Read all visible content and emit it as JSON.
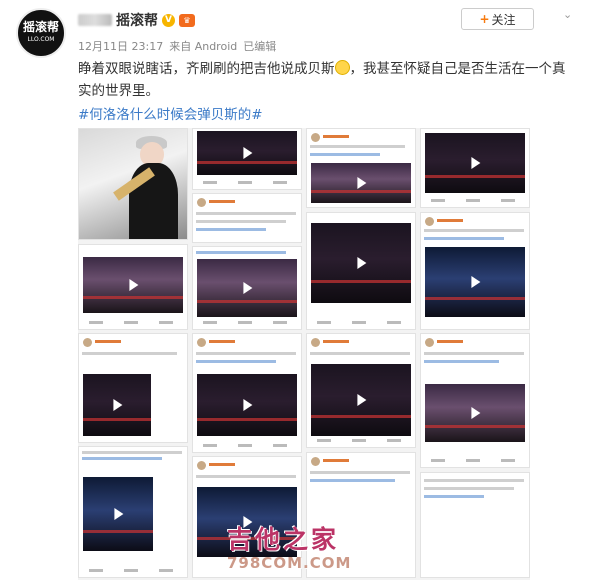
{
  "author": {
    "name": "摇滚帮",
    "avatar_text": "摇滚帮",
    "avatar_subtext": "LLO.COM",
    "verified_badge": "V"
  },
  "meta": {
    "time": "12月11日 23:17",
    "source": "来自 Android",
    "edited": "已编辑"
  },
  "actions": {
    "follow_label": "关注",
    "follow_icon": "plus-icon",
    "menu_icon": "chevron-down-icon"
  },
  "post": {
    "text_part1": "睁着双眼说瞎话，齐刷刷的把吉他说成贝斯",
    "text_part2": "，我甚至怀疑自己是否生活在一个真实的世界里。",
    "hashtag": "#何洛洛什么时候会弹贝斯的#"
  },
  "watermark": {
    "cn": "吉他之家",
    "en": "798COM.COM"
  },
  "colors": {
    "link": "#3b7ac7",
    "accent": "#f77a0e"
  }
}
